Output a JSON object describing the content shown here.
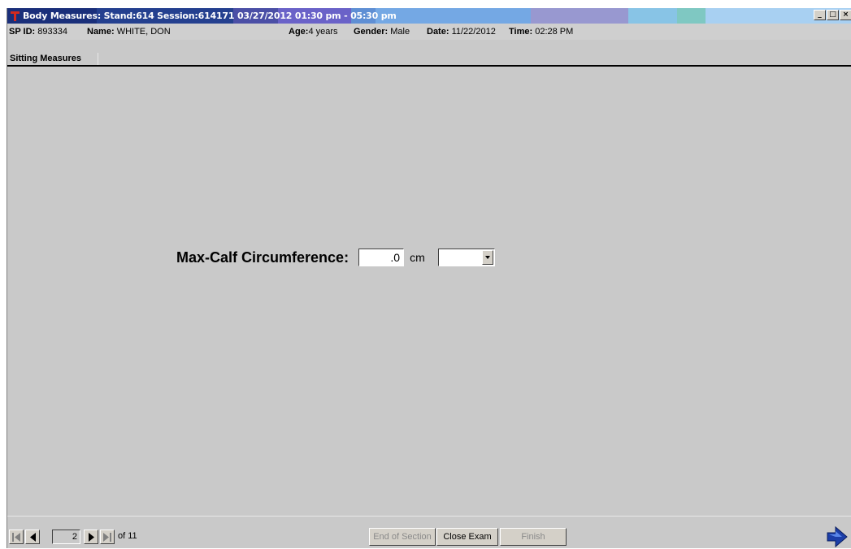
{
  "window": {
    "title": "Body Measures: Stand:614 Session:614171  03/27/2012 01:30 pm - 05:30 pm",
    "title_stripe_colors": [
      "#1a2f7a",
      "#24408f",
      "#4b4fa6",
      "#6a62c8",
      "#5f8fd4",
      "#74a8e4",
      "#9898d0",
      "#88c4e6",
      "#7fc8c2",
      "#a8d0f2"
    ]
  },
  "info": {
    "sp_id_label": "SP ID:",
    "sp_id": "893334",
    "name_label": "Name:",
    "name": "WHITE, DON",
    "age_label": "Age:",
    "age": "4 years",
    "gender_label": "Gender:",
    "gender": "Male",
    "date_label": "Date:",
    "date": "11/22/2012",
    "time_label": "Time:",
    "time": "02:28 PM"
  },
  "section": {
    "tab_label": "Sitting Measures"
  },
  "measure": {
    "label": "Max-Calf Circumference:",
    "value": ".0",
    "unit": "cm",
    "comment_value": ""
  },
  "footer": {
    "current_page": "2",
    "page_total_text": "of 11",
    "end_of_section_label": "End of Section",
    "close_exam_label": "Close Exam",
    "finish_label": "Finish"
  },
  "icons": {
    "first": "first-page-icon",
    "prev": "prev-page-icon",
    "next": "next-page-icon",
    "last": "last-page-icon",
    "exit": "exit-arrow-icon"
  }
}
